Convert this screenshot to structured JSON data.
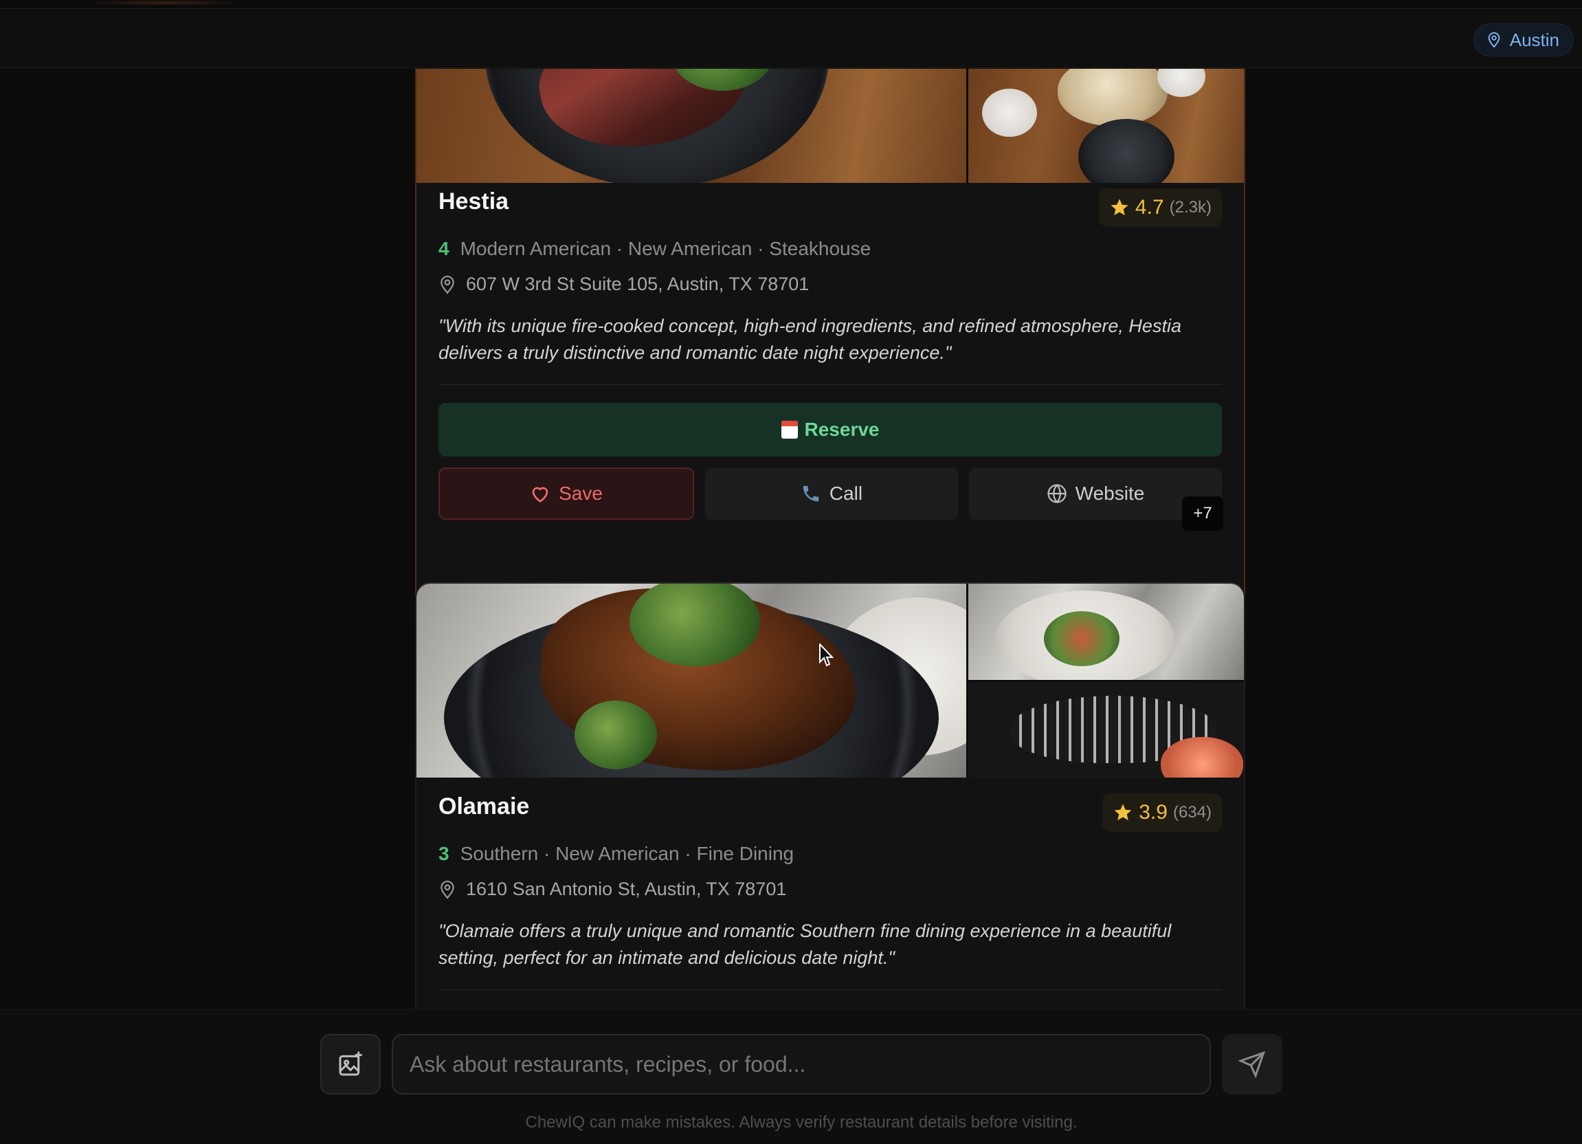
{
  "header": {
    "location": "Austin",
    "location_icon": "map-pin-icon"
  },
  "restaurants": [
    {
      "name": "Hestia",
      "rating": "4.7",
      "review_count": "(2.3k)",
      "price_level": "4",
      "cuisines": "Modern American · New American · Steakhouse",
      "address": "607 W 3rd St Suite 105, Austin, TX 78701",
      "quote": "\"With its unique fire-cooked concept, high-end ingredients, and refined atmosphere, Hestia delivers a truly distinctive and romantic date night experience.\"",
      "reserve_label": "Reserve",
      "save_label": "Save",
      "call_label": "Call",
      "website_label": "Website",
      "more_photos": "+7"
    },
    {
      "name": "Olamaie",
      "rating": "3.9",
      "review_count": "(634)",
      "price_level": "3",
      "cuisines": "Southern · New American · Fine Dining",
      "address": "1610 San Antonio St, Austin, TX 78701",
      "quote": "\"Olamaie offers a truly unique and romantic Southern fine dining experience in a beautiful setting, perfect for an intimate and delicious date night.\""
    }
  ],
  "composer": {
    "placeholder": "Ask about restaurants, recipes, or food...",
    "disclaimer": "ChewIQ can make mistakes. Always verify restaurant details before visiting."
  },
  "colors": {
    "accent_green": "#4fbf76",
    "star_gold": "#f3c13a",
    "save_red": "#ef6a6a",
    "location_blue": "#7fb2ee"
  }
}
